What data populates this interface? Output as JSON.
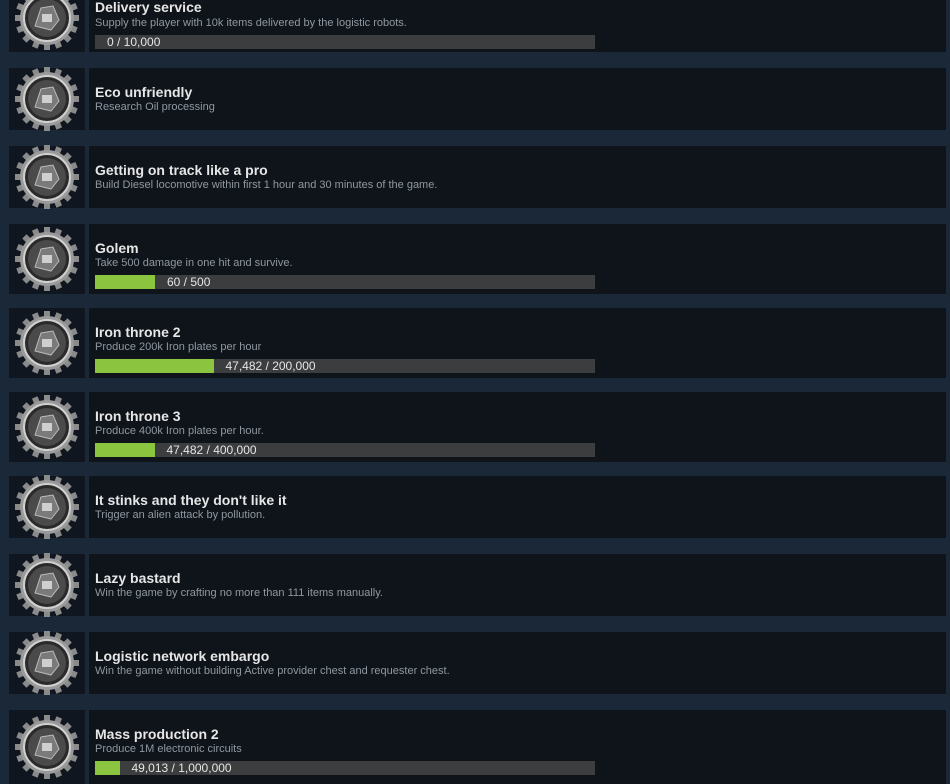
{
  "achievements": [
    {
      "title": "Delivery service",
      "description": "Supply the player with 10k items delivered by the logistic robots.",
      "progress_text": "0 / 10,000",
      "progress": 0.0,
      "icon": "logistic-robot-medal-icon"
    },
    {
      "title": "Eco unfriendly",
      "description": "Research Oil processing",
      "icon": "refinery-medal-icon"
    },
    {
      "title": "Getting on track like a pro",
      "description": "Build Diesel locomotive within first 1 hour and 30 minutes of the game.",
      "icon": "locomotive-medal-icon"
    },
    {
      "title": "Golem",
      "description": "Take 500 damage in one hit and survive.",
      "progress_text": "60 / 500",
      "progress": 0.12,
      "icon": "golem-medal-icon"
    },
    {
      "title": "Iron throne 2",
      "description": "Produce 200k Iron plates per hour",
      "progress_text": "47,482 / 200,000",
      "progress": 0.237,
      "icon": "iron-throne-medal-icon"
    },
    {
      "title": "Iron throne 3",
      "description": "Produce 400k Iron plates per hour.",
      "progress_text": "47,482 / 400,000",
      "progress": 0.119,
      "icon": "iron-throne-medal-icon"
    },
    {
      "title": "It stinks and they don't like it",
      "description": "Trigger an alien attack by pollution.",
      "icon": "alien-medal-icon"
    },
    {
      "title": "Lazy bastard",
      "description": "Win the game by crafting no more than 111 items manually.",
      "icon": "lazy-bastard-medal-icon"
    },
    {
      "title": "Logistic network embargo",
      "description": "Win the game without building Active provider chest and requester chest.",
      "icon": "chest-embargo-medal-icon"
    },
    {
      "title": "Mass production 2",
      "description": "Produce 1M electronic circuits",
      "progress_text": "49,013 / 1,000,000",
      "progress": 0.049,
      "icon": "circuits-medal-icon"
    }
  ],
  "colors": {
    "background": "#1b2838",
    "row": "#0f141b",
    "bar_track": "#3c3d3e",
    "bar_fill": "#8bc53f",
    "title": "#e6e6e6",
    "desc": "#8f98a0"
  }
}
